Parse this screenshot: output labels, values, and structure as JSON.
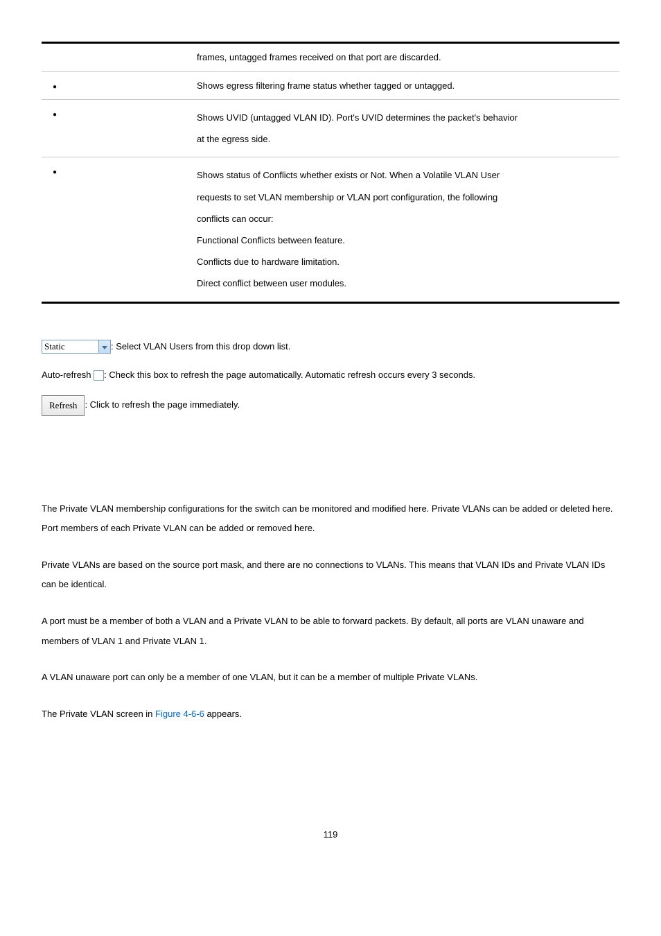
{
  "table": {
    "row0": "frames, untagged frames received on that port are discarded.",
    "row1": "Shows egress filtering frame status whether tagged or untagged.",
    "row2_l1": "Shows UVID (untagged VLAN ID). Port's UVID determines the packet's behavior",
    "row2_l2": "at the egress side.",
    "row3_l1": "Shows status of Conflicts whether exists or Not. When a Volatile VLAN User",
    "row3_l2": "requests to set VLAN membership or VLAN port configuration, the following",
    "row3_l3": "conflicts can occur:",
    "row3_l4": "Functional Conflicts between feature.",
    "row3_l5": "Conflicts due to hardware limitation.",
    "row3_l6": "Direct conflict between user modules."
  },
  "controls": {
    "dropdown_value": "Static",
    "dropdown_desc": ": Select VLAN Users from this drop down list.",
    "autorefresh_label": "Auto-refresh",
    "autorefresh_desc": ": Check this box to refresh the page automatically. Automatic refresh occurs every 3 seconds.",
    "refresh_label": "Refresh",
    "refresh_desc": ": Click to refresh the page immediately."
  },
  "body": {
    "p1": "The Private VLAN membership configurations for the switch can be monitored and modified here. Private VLANs can be added or deleted here. Port members of each Private VLAN can be added or removed here.",
    "p2": "Private VLANs are based on the source port mask, and there are no connections to VLANs. This means that VLAN IDs and Private VLAN IDs can be identical.",
    "p3": "A port must be a member of both a VLAN and a Private VLAN to be able to forward packets. By default, all ports are VLAN unaware and members of VLAN 1 and Private VLAN 1.",
    "p4": "A VLAN unaware port can only be a member of one VLAN, but it can be a member of multiple Private VLANs.",
    "p5_a": "The Private VLAN screen in ",
    "p5_link": "Figure 4-6-6",
    "p5_b": " appears."
  },
  "page_number": "119"
}
